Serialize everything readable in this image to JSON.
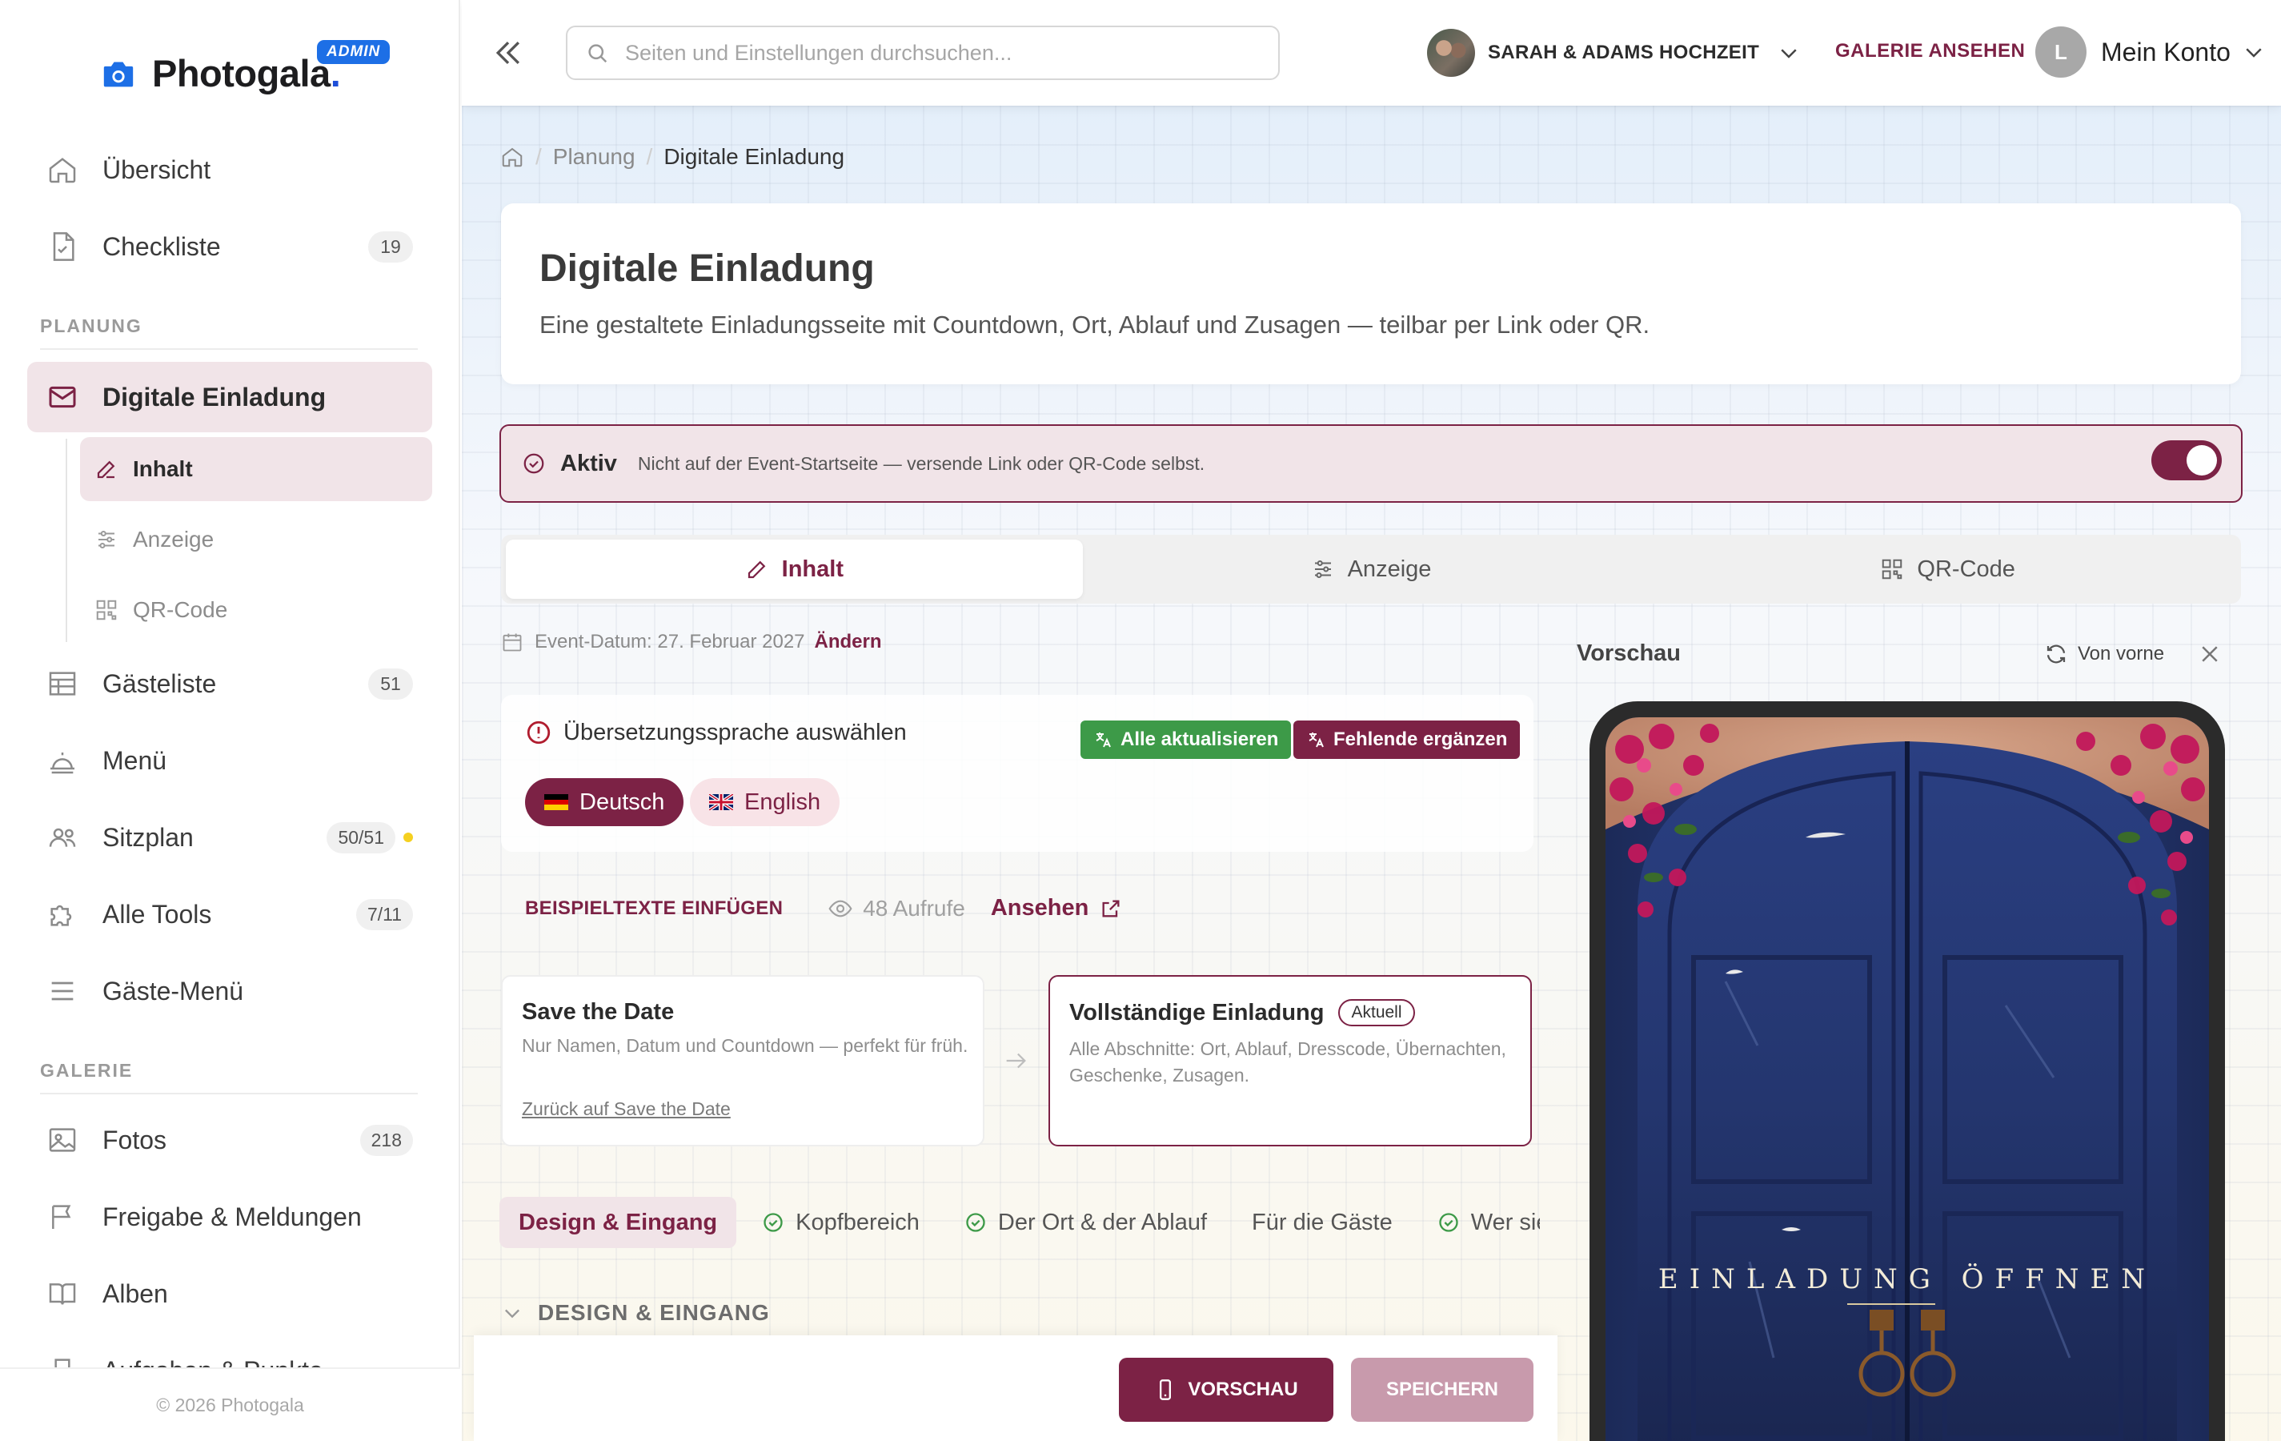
{
  "app": {
    "brand": "Photogala",
    "brand_dot": ".",
    "admin_badge": "ADMIN",
    "footer": "© 2026 Photogala"
  },
  "sidebar": {
    "items_top": [
      {
        "label": "Übersicht",
        "icon": "home-icon"
      },
      {
        "label": "Checkliste",
        "icon": "file-check-icon",
        "badge": "19"
      }
    ],
    "section_planning": "PLANUNG",
    "invitation": {
      "label": "Digitale Einladung",
      "icon": "mail-icon"
    },
    "sub_items": [
      {
        "label": "Inhalt",
        "icon": "edit-icon"
      },
      {
        "label": "Anzeige",
        "icon": "sliders-icon"
      },
      {
        "label": "QR-Code",
        "icon": "qr-icon"
      }
    ],
    "items_planning": [
      {
        "label": "Gästeliste",
        "icon": "table-icon",
        "badge": "51"
      },
      {
        "label": "Menü",
        "icon": "cloche-icon"
      },
      {
        "label": "Sitzplan",
        "icon": "users-icon",
        "badge": "50/51"
      },
      {
        "label": "Alle Tools",
        "icon": "puzzle-icon",
        "badge": "7/11"
      },
      {
        "label": "Gäste-Menü",
        "icon": "menu-icon"
      }
    ],
    "section_gallery": "GALERIE",
    "items_gallery": [
      {
        "label": "Fotos",
        "icon": "image-icon",
        "badge": "218"
      },
      {
        "label": "Freigabe & Meldungen",
        "icon": "flag-icon"
      },
      {
        "label": "Alben",
        "icon": "book-icon"
      },
      {
        "label": "Aufgaben & Punkte",
        "icon": "trophy-icon"
      }
    ]
  },
  "topbar": {
    "search_placeholder": "Seiten und Einstellungen durchsuchen...",
    "event_name": "SARAH & ADAMS HOCHZEIT",
    "gallery_link": "GALERIE ANSEHEN",
    "account_initial": "L",
    "account_label": "Mein Konto"
  },
  "breadcrumb": {
    "parent": "Planung",
    "current": "Digitale Einladung"
  },
  "header": {
    "title": "Digitale Einladung",
    "subtitle": "Eine gestaltete Einladungsseite mit Countdown, Ort, Ablauf und Zusagen — teilbar per Link oder QR."
  },
  "status": {
    "label": "Aktiv",
    "description": "Nicht auf der Event-Startseite — versende Link oder QR-Code selbst.",
    "enabled": true
  },
  "tabs": [
    {
      "label": "Inhalt",
      "icon": "edit-icon"
    },
    {
      "label": "Anzeige",
      "icon": "sliders-icon"
    },
    {
      "label": "QR-Code",
      "icon": "qr-icon"
    }
  ],
  "event_date": {
    "text": "Event-Datum: 27. Februar 2027",
    "change": "Ändern"
  },
  "translation": {
    "title": "Übersetzungssprache auswählen",
    "update_all": "Alle aktualisieren",
    "fill_missing": "Fehlende ergänzen",
    "languages": [
      {
        "label": "Deutsch",
        "selected": true
      },
      {
        "label": "English",
        "selected": false
      }
    ]
  },
  "samples": {
    "insert": "BEISPIELTEXTE EINFÜGEN",
    "views": "48 Aufrufe",
    "view_link": "Ansehen"
  },
  "options": {
    "save_the_date": {
      "title": "Save the Date",
      "desc": "Nur Namen, Datum und Countdown — perfekt für früh.",
      "back": "Zurück auf Save the Date"
    },
    "full": {
      "title": "Vollständige Einladung",
      "badge": "Aktuell",
      "desc": "Alle Abschnitte: Ort, Ablauf, Dresscode, Übernachten, Geschenke, Zusagen."
    }
  },
  "section_tabs": [
    {
      "label": "Design & Eingang",
      "done": false
    },
    {
      "label": "Kopfbereich",
      "done": true
    },
    {
      "label": "Der Ort & der Ablauf",
      "done": true
    },
    {
      "label": "Für die Gäste",
      "done": false
    },
    {
      "label": "Wer sieht was",
      "done": true
    }
  ],
  "section_heading": "DESIGN & EINGANG",
  "actions": {
    "preview": "VORSCHAU",
    "save": "SPEICHERN"
  },
  "preview": {
    "title": "Vorschau",
    "restart": "Von vorne",
    "open_text": "EINLADUNG ÖFFNEN"
  },
  "colors": {
    "accent": "#7c2245",
    "accent_light": "#f1e4e8",
    "success": "#3d9a48",
    "brand_blue": "#1d6fe6"
  }
}
